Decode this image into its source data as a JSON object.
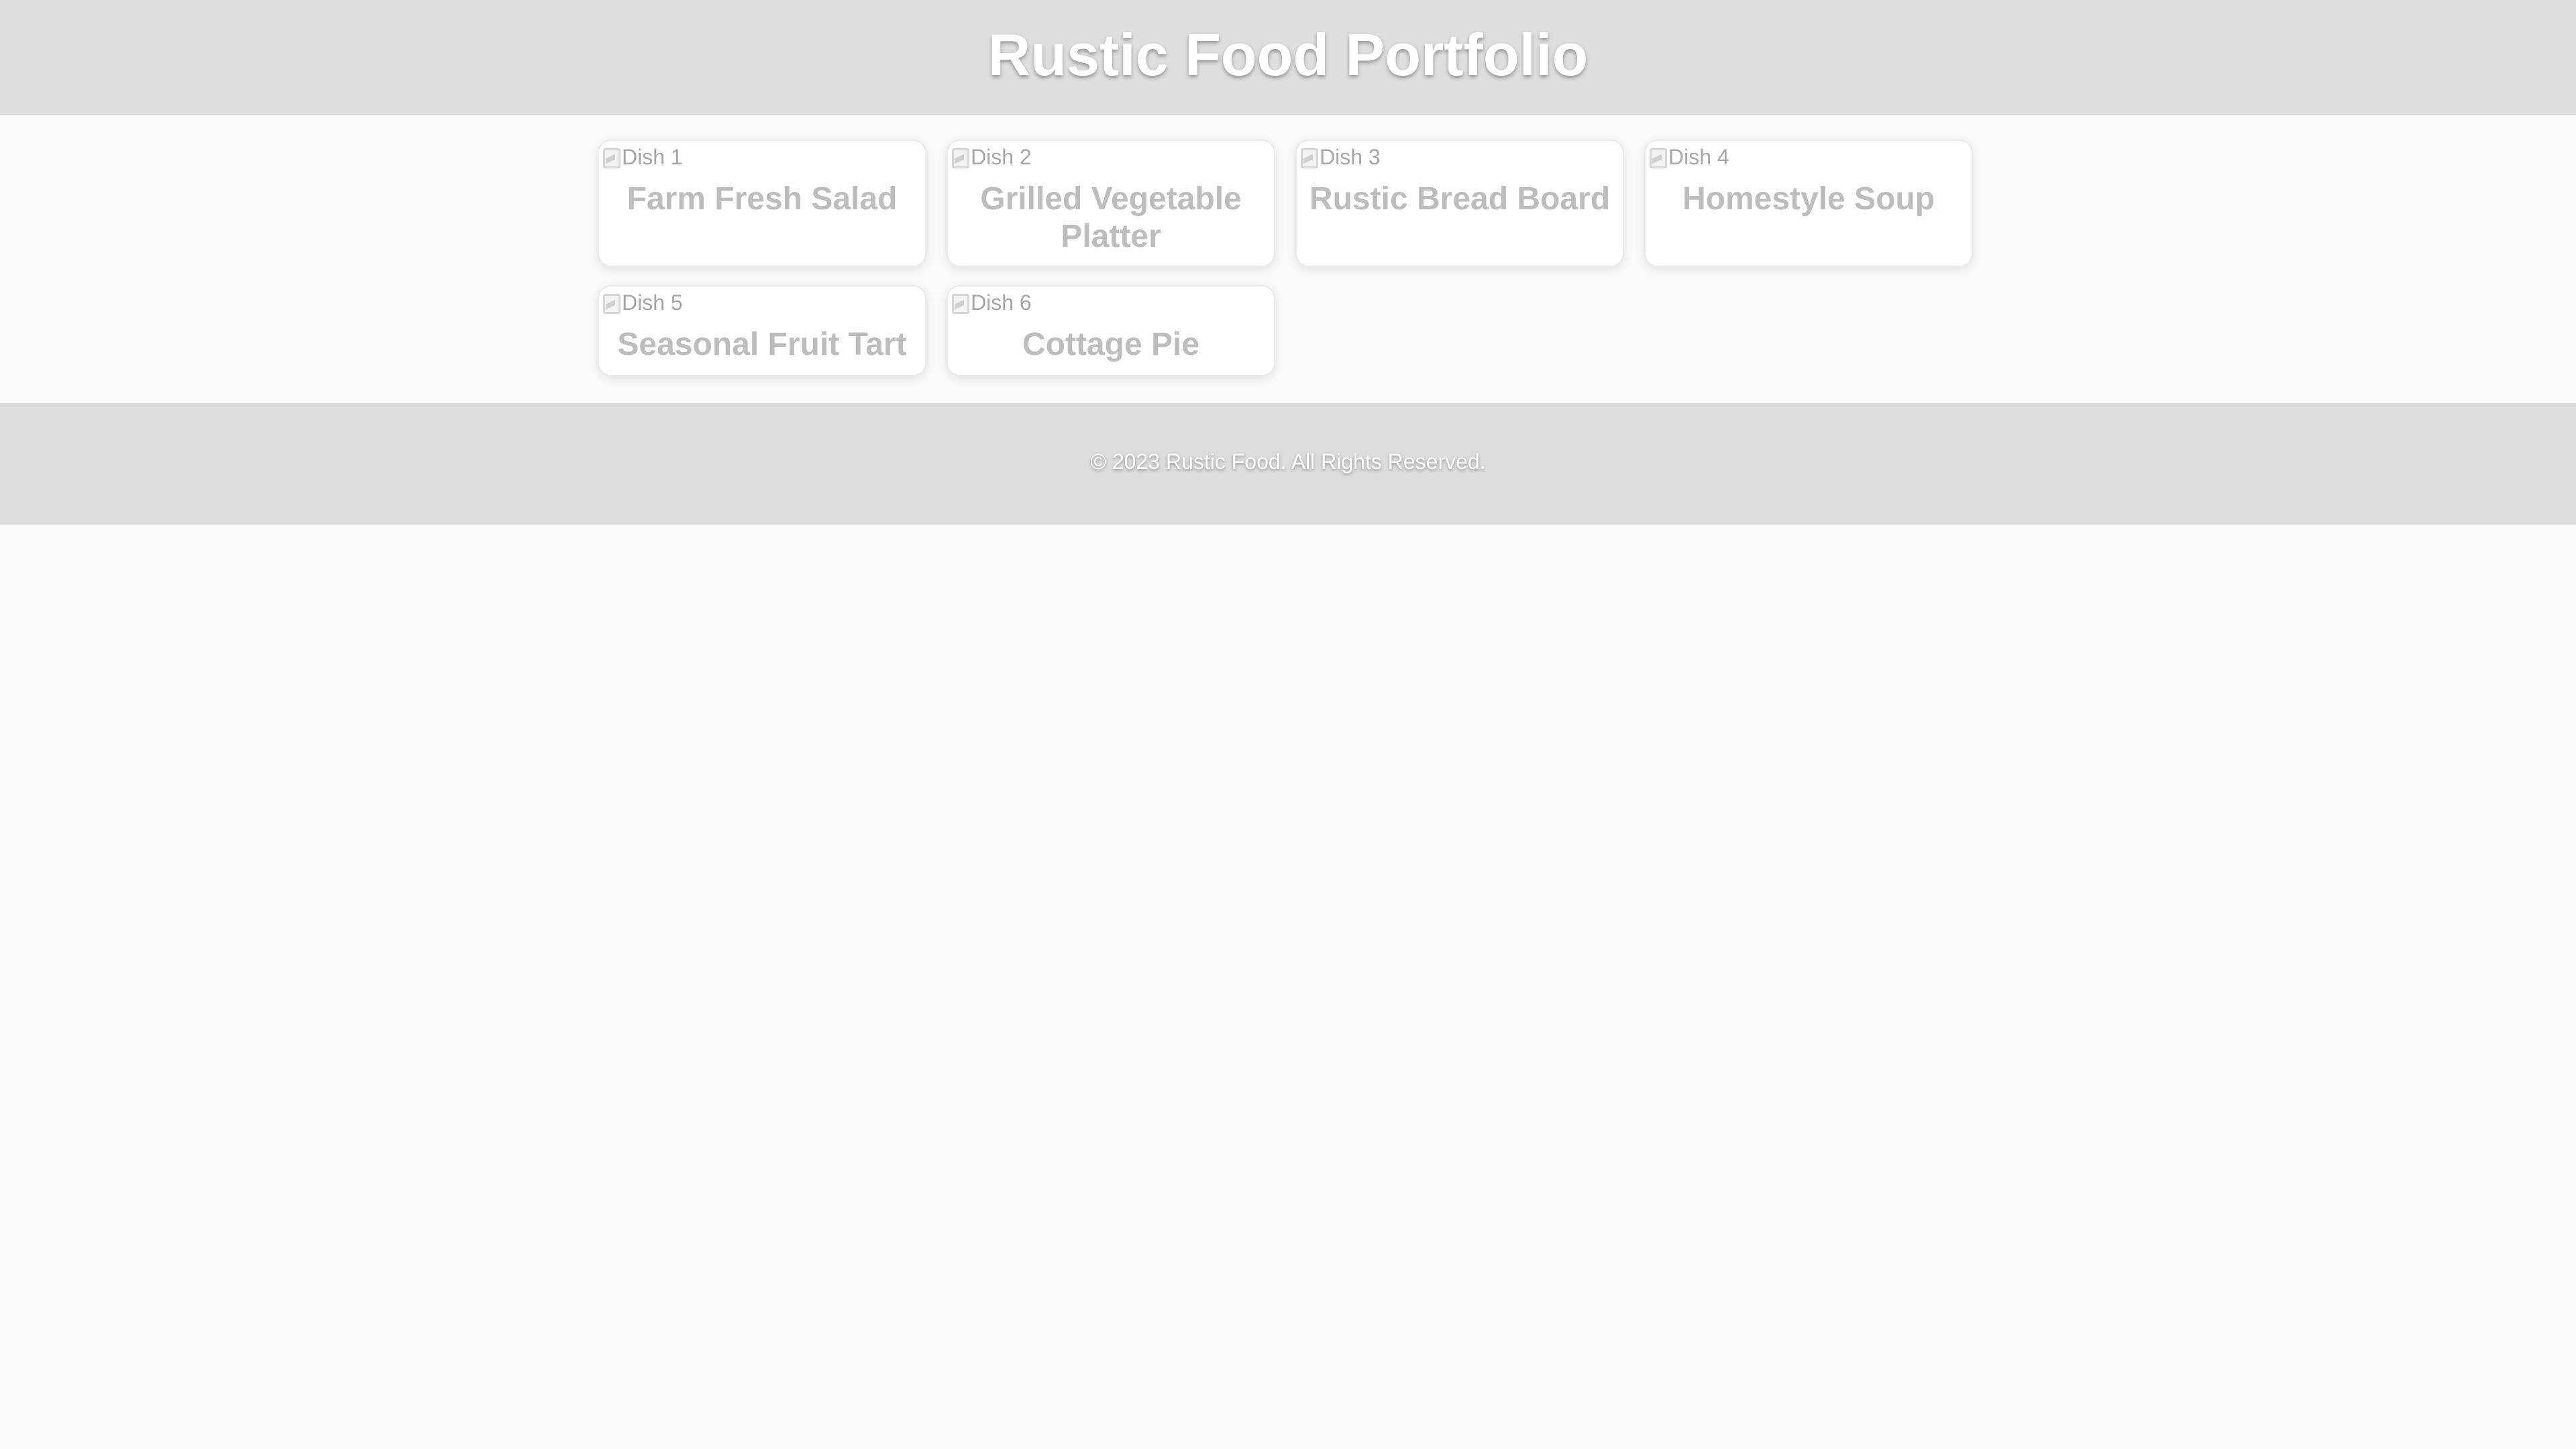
{
  "header": {
    "title": "Rustic Food Portfolio"
  },
  "gallery": {
    "items": [
      {
        "image_alt": "Dish 1",
        "title": "Farm Fresh Salad"
      },
      {
        "image_alt": "Dish 2",
        "title": "Grilled Vegetable Platter"
      },
      {
        "image_alt": "Dish 3",
        "title": "Rustic Bread Board"
      },
      {
        "image_alt": "Dish 4",
        "title": "Homestyle Soup"
      },
      {
        "image_alt": "Dish 5",
        "title": "Seasonal Fruit Tart"
      },
      {
        "image_alt": "Dish 6",
        "title": "Cottage Pie"
      }
    ]
  },
  "footer": {
    "text": "© 2023 Rustic Food. All Rights Reserved."
  },
  "colors": {
    "page_background": "#fafafa",
    "header_background": "#dedede",
    "footer_background": "#dcdcdc",
    "card_background": "#ffffff",
    "card_title": "#bdbdbd",
    "header_text": "#ffffff"
  }
}
